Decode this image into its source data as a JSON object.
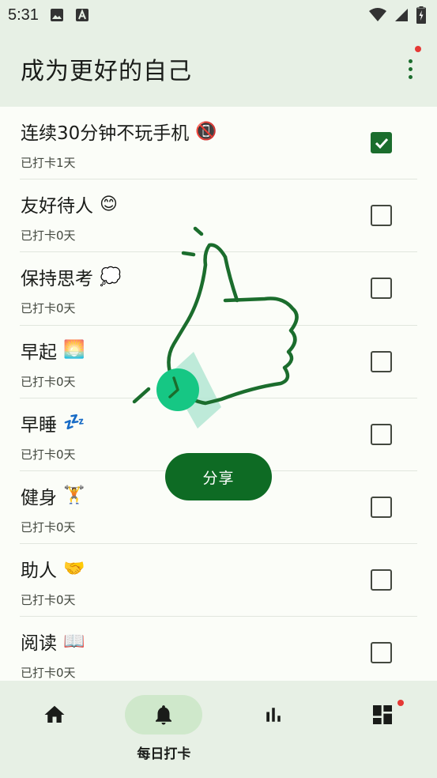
{
  "status_bar": {
    "time": "5:31",
    "icons": [
      "image-icon",
      "text-a-icon",
      "wifi-icon",
      "signal-icon",
      "battery-charging-icon"
    ]
  },
  "app_bar": {
    "title": "成为更好的自己",
    "menu_icon": "more-vert-icon"
  },
  "habits": [
    {
      "name": "连续30分钟不玩手机",
      "emoji": "📵",
      "days": "已打卡1天",
      "checked": true
    },
    {
      "name": "友好待人",
      "emoji": "😊",
      "days": "已打卡0天",
      "checked": false
    },
    {
      "name": "保持思考",
      "emoji": "💭",
      "days": "已打卡0天",
      "checked": false
    },
    {
      "name": "早起",
      "emoji": "🌅",
      "days": "已打卡0天",
      "checked": false
    },
    {
      "name": "早睡",
      "emoji": "💤",
      "days": "已打卡0天",
      "checked": false
    },
    {
      "name": "健身",
      "emoji": "🏋️",
      "days": "已打卡0天",
      "checked": false
    },
    {
      "name": "助人",
      "emoji": "🤝",
      "days": "已打卡0天",
      "checked": false
    },
    {
      "name": "阅读",
      "emoji": "📖",
      "days": "已打卡0天",
      "checked": false
    }
  ],
  "share": {
    "label": "分享"
  },
  "bottom_nav": {
    "items": [
      {
        "icon": "home-icon",
        "label": ""
      },
      {
        "icon": "bell-icon",
        "label": "每日打卡"
      },
      {
        "icon": "bar-chart-icon",
        "label": ""
      },
      {
        "icon": "dashboard-icon",
        "label": ""
      }
    ],
    "active_index": 1
  },
  "colors": {
    "accent": "#1b6d2d",
    "bar_bg": "#e7f0e5",
    "badge": "#e53935",
    "share_bg": "#0e6b24"
  }
}
